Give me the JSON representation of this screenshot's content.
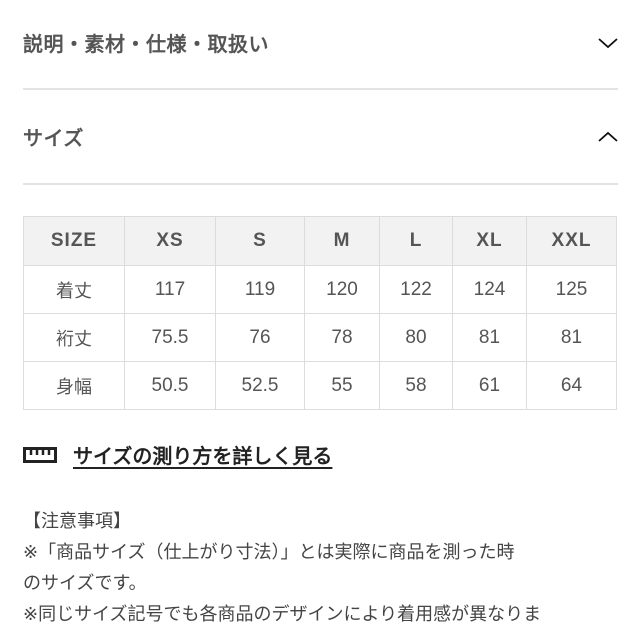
{
  "sections": [
    {
      "title": "説明・素材・仕様・取扱い",
      "expanded": false,
      "icon": "chevron-down-icon"
    },
    {
      "title": "サイズ",
      "expanded": true,
      "icon": "chevron-up-icon"
    }
  ],
  "size_table": {
    "headers": [
      "SIZE",
      "XS",
      "S",
      "M",
      "L",
      "XL",
      "XXL"
    ],
    "rows": [
      {
        "label": "着丈",
        "values": [
          "117",
          "119",
          "120",
          "122",
          "124",
          "125"
        ]
      },
      {
        "label": "裄丈",
        "values": [
          "75.5",
          "76",
          "78",
          "80",
          "81",
          "81"
        ]
      },
      {
        "label": "身幅",
        "values": [
          "50.5",
          "52.5",
          "55",
          "58",
          "61",
          "64"
        ]
      }
    ]
  },
  "measure_link": {
    "icon": "ruler-icon",
    "label": "サイズの測り方を詳しく見る"
  },
  "notes": {
    "heading": "【注意事項】",
    "lines": [
      "※「商品サイズ（仕上がり寸法）」とは実際に商品を測った時",
      "のサイズです。",
      "※同じサイズ記号でも各商品のデザインにより着用感が異なりま"
    ]
  }
}
